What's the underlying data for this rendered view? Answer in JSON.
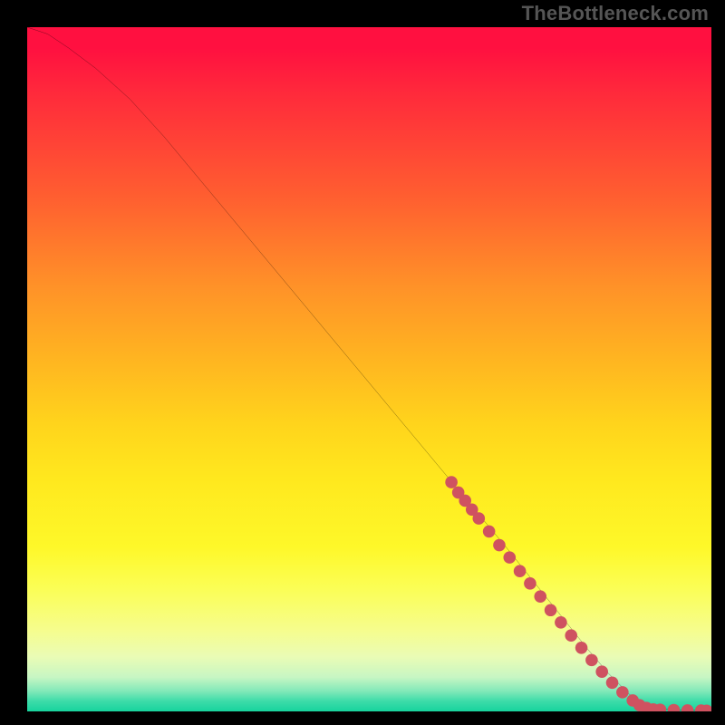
{
  "watermark": "TheBottleneck.com",
  "chart_data": {
    "type": "line",
    "title": "",
    "xlabel": "",
    "ylabel": "",
    "xlim": [
      0,
      100
    ],
    "ylim": [
      0,
      100
    ],
    "grid": false,
    "series": [
      {
        "name": "curve",
        "x": [
          0,
          3,
          6,
          10,
          15,
          20,
          25,
          30,
          35,
          40,
          45,
          50,
          55,
          60,
          65,
          70,
          74,
          78,
          82,
          85,
          88,
          90,
          92,
          94,
          96,
          98,
          100
        ],
        "y": [
          100,
          99,
          97,
          94,
          89.5,
          84,
          78,
          72,
          66,
          60,
          54,
          48,
          42,
          36,
          30,
          24,
          19,
          14,
          9,
          5.5,
          2.5,
          1,
          0.5,
          0.3,
          0.2,
          0.15,
          0.1
        ]
      }
    ],
    "markers": [
      {
        "x": 62,
        "y": 33.5
      },
      {
        "x": 63,
        "y": 32.0
      },
      {
        "x": 64,
        "y": 30.8
      },
      {
        "x": 65,
        "y": 29.5
      },
      {
        "x": 66,
        "y": 28.2
      },
      {
        "x": 67.5,
        "y": 26.3
      },
      {
        "x": 69,
        "y": 24.3
      },
      {
        "x": 70.5,
        "y": 22.5
      },
      {
        "x": 72,
        "y": 20.5
      },
      {
        "x": 73.5,
        "y": 18.7
      },
      {
        "x": 75,
        "y": 16.8
      },
      {
        "x": 76.5,
        "y": 14.8
      },
      {
        "x": 78,
        "y": 13.0
      },
      {
        "x": 79.5,
        "y": 11.1
      },
      {
        "x": 81,
        "y": 9.3
      },
      {
        "x": 82.5,
        "y": 7.5
      },
      {
        "x": 84,
        "y": 5.8
      },
      {
        "x": 85.5,
        "y": 4.2
      },
      {
        "x": 87,
        "y": 2.8
      },
      {
        "x": 88.5,
        "y": 1.6
      },
      {
        "x": 89.5,
        "y": 0.9
      },
      {
        "x": 90.5,
        "y": 0.5
      },
      {
        "x": 91.5,
        "y": 0.3
      },
      {
        "x": 92.5,
        "y": 0.25
      },
      {
        "x": 94.5,
        "y": 0.2
      },
      {
        "x": 96.5,
        "y": 0.15
      },
      {
        "x": 98.5,
        "y": 0.12
      },
      {
        "x": 99.3,
        "y": 0.1
      }
    ],
    "marker_color": "#cf5260",
    "curve_color": "#000000",
    "background": "gradient-red-yellow-green"
  }
}
